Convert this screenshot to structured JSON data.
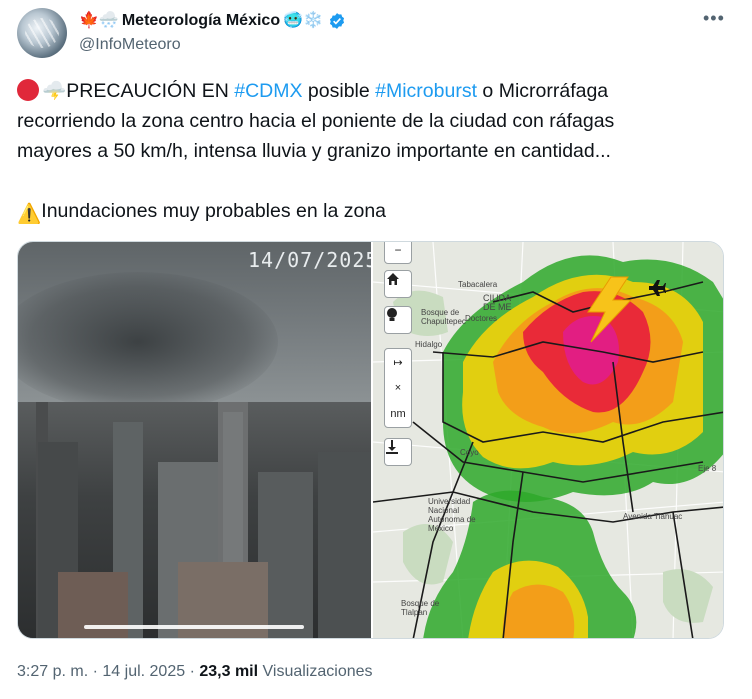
{
  "author": {
    "display_name": "Meteorología México",
    "name_emoji_before": "🍁🌨️",
    "name_emoji_after": "🥶❄️",
    "handle": "@InfoMeteoro",
    "verified": true,
    "avatar_icon": "frost-avatar"
  },
  "tweet": {
    "emoji_prefix": "🌩️",
    "text_1a": "PRECAUCIÓN EN ",
    "hashtag_1": "#CDMX",
    "text_1b": " posible ",
    "hashtag_2": "#Microburst",
    "text_1c": " o Microrráfaga",
    "line_2": "recorriendo la zona centro hacia el poniente de la ciudad con ráfagas",
    "line_3": "mayores a 50 km/h, intensa lluvia y granizo importante en cantidad...",
    "warning_emoji": "⚠️",
    "line_5": "Inundaciones muy probables en la zona"
  },
  "media": {
    "camera_timestamp": "14/07/2025",
    "map_labels": {
      "tabacalera": "Tabacalera",
      "ciudad_de_mexico": "CIUDA\nDE ME",
      "bosque_chapultepec": "Bosque de\nChapultepec",
      "doctores": "Doctores",
      "hidalgo": "Hidalgo",
      "coyoacan": "Coyo",
      "unam": "Universidad\nNacional\nAutónoma de\nMéxico",
      "avenida_tlahuac": "Avenida Tláhuac",
      "bosque_tlalpan": "Bosque de\nTlalpan",
      "eje_8": "Eje 8"
    },
    "map_controls": [
      "home",
      "lightbulb",
      "distance",
      "close",
      "nm",
      "download"
    ],
    "map_control_labels": {
      "measure": "↦",
      "close": "×",
      "units": "nm"
    }
  },
  "footer": {
    "time": "3:27 p. m.",
    "separator": "·",
    "date": "14 jul. 2025",
    "views_count": "23,3 mil",
    "views_label": "Visualizaciones"
  },
  "colors": {
    "accent": "#1d9bf0",
    "text": "#0f1419",
    "muted": "#536471"
  }
}
